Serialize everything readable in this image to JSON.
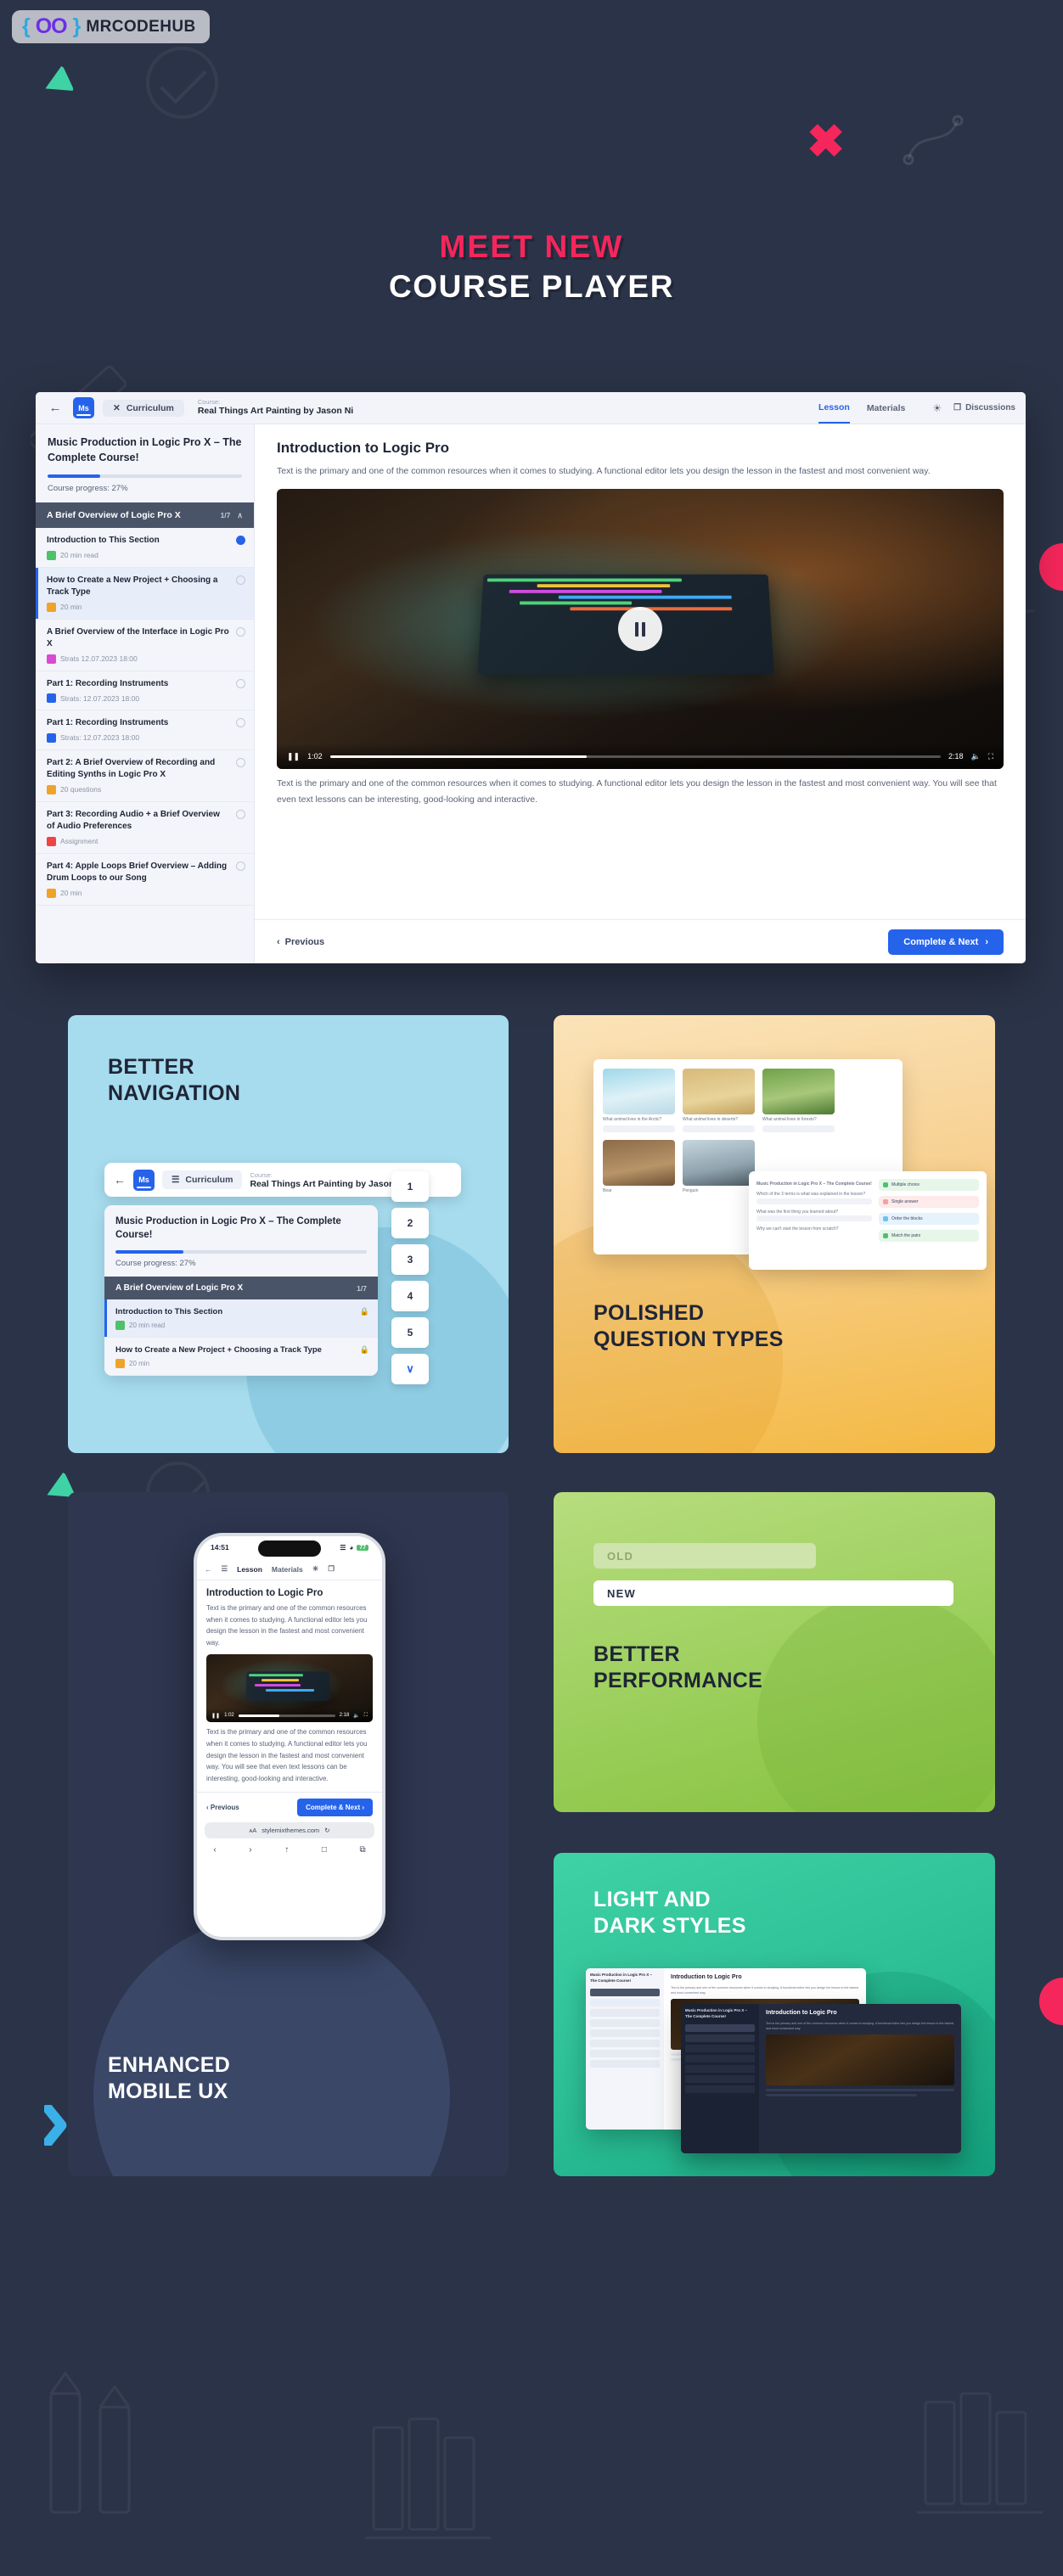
{
  "brand": {
    "braces_left": "{",
    "braces_right": "}",
    "oo": "OO",
    "name": "MRCODEHUB"
  },
  "hero": {
    "line1": "MEET NEW",
    "line2": "COURSE PLAYER",
    "accent_color": "#f5265c",
    "bg_color": "#2b3348"
  },
  "player": {
    "back_icon": "←",
    "logo_text": "Ms",
    "curriculum_icon": "✕",
    "curriculum_label": "Curriculum",
    "course_label": "Course:",
    "course_name": "Real Things Art Painting by Jason Ni",
    "tabs": [
      {
        "label": "Lesson",
        "active": true
      },
      {
        "label": "Materials",
        "active": false
      }
    ],
    "brightness_icon": "☀",
    "discussions_icon": "❐",
    "discussions_label": "Discussions",
    "sidebar": {
      "title": "Music Production in Logic Pro X – The Complete Course!",
      "progress_percent": 27,
      "progress_label": "Course progress: 27%",
      "section": {
        "title": "A Brief Overview of Logic Pro X",
        "count": "1/7",
        "chevron": "∧"
      },
      "lessons": [
        {
          "title": "Introduction to This Section",
          "meta": "20 min read",
          "icon": "doc",
          "icon_color": "#4ec16a",
          "state": "done",
          "active": false
        },
        {
          "title": "How to Create a New Project + Choosing a Track Type",
          "meta": "20 min",
          "icon": "audio",
          "icon_color": "#f0a32a",
          "state": "todo",
          "active": true
        },
        {
          "title": "A Brief Overview of the Interface in Logic Pro X",
          "meta": "Strats 12.07.2023 18:00",
          "icon": "quiz",
          "icon_color": "#d74bd4",
          "state": "todo",
          "active": false
        },
        {
          "title": "Part 1: Recording Instruments",
          "meta": "Strats: 12.07.2023 18:00",
          "icon": "video",
          "icon_color": "#2563eb",
          "state": "todo",
          "active": false
        },
        {
          "title": "Part 1: Recording Instruments",
          "meta": "Strats: 12.07.2023 18:00",
          "icon": "stream",
          "icon_color": "#2563eb",
          "state": "todo",
          "active": false
        },
        {
          "title": "Part 2: A Brief Overview of Recording and Editing Synths in Logic Pro X",
          "meta": "20 questions",
          "icon": "quiz2",
          "icon_color": "#f0a32a",
          "state": "todo",
          "active": false
        },
        {
          "title": "Part 3: Recording Audio + a Brief Overview of Audio Preferences",
          "meta": "Assignment",
          "icon": "assign",
          "icon_color": "#ef4444",
          "state": "todo",
          "active": false
        },
        {
          "title": "Part 4: Apple Loops Brief Overview – Adding Drum Loops to our Song",
          "meta": "20 min",
          "icon": "audio",
          "icon_color": "#f0a32a",
          "state": "todo",
          "active": false
        }
      ]
    },
    "lesson": {
      "heading": "Introduction to Logic Pro",
      "intro": "Text is the primary and one of the common resources when it comes to studying. A functional editor lets you design the lesson in the fastest and most convenient way.",
      "outro": "Text is the primary and one of the common resources when it comes to studying. A functional editor lets you design the lesson in the fastest and most convenient way. You will see that even text lessons can be interesting, good-looking and interactive.",
      "video": {
        "current_time": "1:02",
        "total_time": "2:18",
        "progress_percent": 42,
        "play_icon": "pause",
        "volume_icon": "🔊",
        "fullscreen_icon": "⛶"
      },
      "previous_label": "Previous",
      "previous_icon": "‹",
      "next_label": "Complete & Next",
      "next_icon": "›"
    }
  },
  "cards": [
    {
      "id": "navigation",
      "heading_line1": "BETTER",
      "heading_line2": "NAVIGATION",
      "bg": "#a6dcee",
      "widget": {
        "back_icon": "←",
        "logo_text": "Ms",
        "menu_icon": "☰",
        "curriculum_label": "Curriculum",
        "course_label": "Course:",
        "course_name": "Real Things Art Painting by Jason Ni",
        "panel_title": "Music Production in Logic Pro X – The Complete Course!",
        "progress_percent": 27,
        "progress_label": "Course progress: 27%",
        "section_title": "A Brief Overview of Logic Pro X",
        "section_count": "1/7",
        "lessons": [
          {
            "title": "Introduction to This Section",
            "meta": "20 min read",
            "locked": true,
            "selected": true
          },
          {
            "title": "How to Create a New Project + Choosing a Track Type",
            "meta": "20 min",
            "locked": true,
            "selected": false
          }
        ],
        "pager": [
          "1",
          "2",
          "3",
          "4",
          "5"
        ],
        "pager_chevron": "∨"
      }
    },
    {
      "id": "questions",
      "heading_line1": "POLISHED",
      "heading_line2": "QUESTION TYPES",
      "bg": "#f4b942",
      "quiz": {
        "options": [
          {
            "caption": "What animal lives in the Arctic?"
          },
          {
            "caption": "What animal lives in deserts?"
          },
          {
            "caption": "What animal lives in forests?"
          }
        ],
        "options2": [
          {
            "caption": "Bear"
          },
          {
            "caption": "Penguin"
          }
        ],
        "prompt": "Music Production in Logic Pro X – The Complete Course!",
        "answers": [
          {
            "text": "Multiple choice",
            "color": "#4ec16a"
          },
          {
            "text": "Single answer",
            "color": "#f5a0a0"
          },
          {
            "text": "Order the blocks",
            "color": "#6fc1f0"
          },
          {
            "text": "Match the pairs",
            "color": "#4ec16a"
          }
        ],
        "questions": [
          "Which of the 3 terms is what was explained in the lesson?",
          "What was the first thing you learned about?",
          "Why we can't start the lesson from scratch?"
        ]
      }
    },
    {
      "id": "mobile",
      "heading_line1": "ENHANCED",
      "heading_line2": "MOBILE UX",
      "bg": "#2e3650",
      "phone": {
        "time": "14:51",
        "battery": "77",
        "nav": [
          {
            "label": "←",
            "active": false
          },
          {
            "label": "☰",
            "active": false
          },
          {
            "label": "Lesson",
            "active": true
          },
          {
            "label": "Materials",
            "active": false
          },
          {
            "label": "☀",
            "active": false
          },
          {
            "label": "❐",
            "active": false
          }
        ],
        "heading": "Introduction to Logic Pro",
        "intro": "Text is the primary and one of the common resources when it comes to studying. A functional editor lets you design the lesson in the fastest and most convenient way.",
        "outro": "Text is the primary and one of the common resources when it comes to studying. A functional editor lets you design the lesson in the fastest and most convenient way. You will see that even text lessons can be interesting, good-looking and interactive.",
        "video_current": "1:02",
        "video_total": "2:18",
        "previous_label": "Previous",
        "next_label": "Complete & Next",
        "url": "stylemixthemes.com",
        "url_prefix": "ᴀA",
        "reload_icon": "↻",
        "browser_tabs": [
          "‹",
          "›",
          "↑",
          "□",
          "⧉"
        ]
      }
    },
    {
      "id": "performance",
      "heading_line1": "BETTER",
      "heading_line2": "PERFORMANCE",
      "bg": "#9ed05f",
      "bar_old": "OLD",
      "bar_new": "NEW"
    },
    {
      "id": "styles",
      "heading_line1": "LIGHT AND",
      "heading_line2": "DARK STYLES",
      "bg": "#2bbd94",
      "preview": {
        "light_title": "Introduction to Logic Pro",
        "light_sidebar_title": "Music Production in Logic Pro X – The Complete Course!",
        "light_body": "Text is the primary and one of the common resources when it comes to studying. A functional editor lets you design the lesson in the fastest and most convenient way.",
        "dark_title": "Introduction to Logic Pro",
        "dark_sidebar_title": "Music Production in Logic Pro X – The Complete Course!",
        "dark_body": "Text is the primary and one of the common resources when it comes to studying. A functional editor lets you design the lesson in the fastest and most convenient way."
      }
    }
  ]
}
